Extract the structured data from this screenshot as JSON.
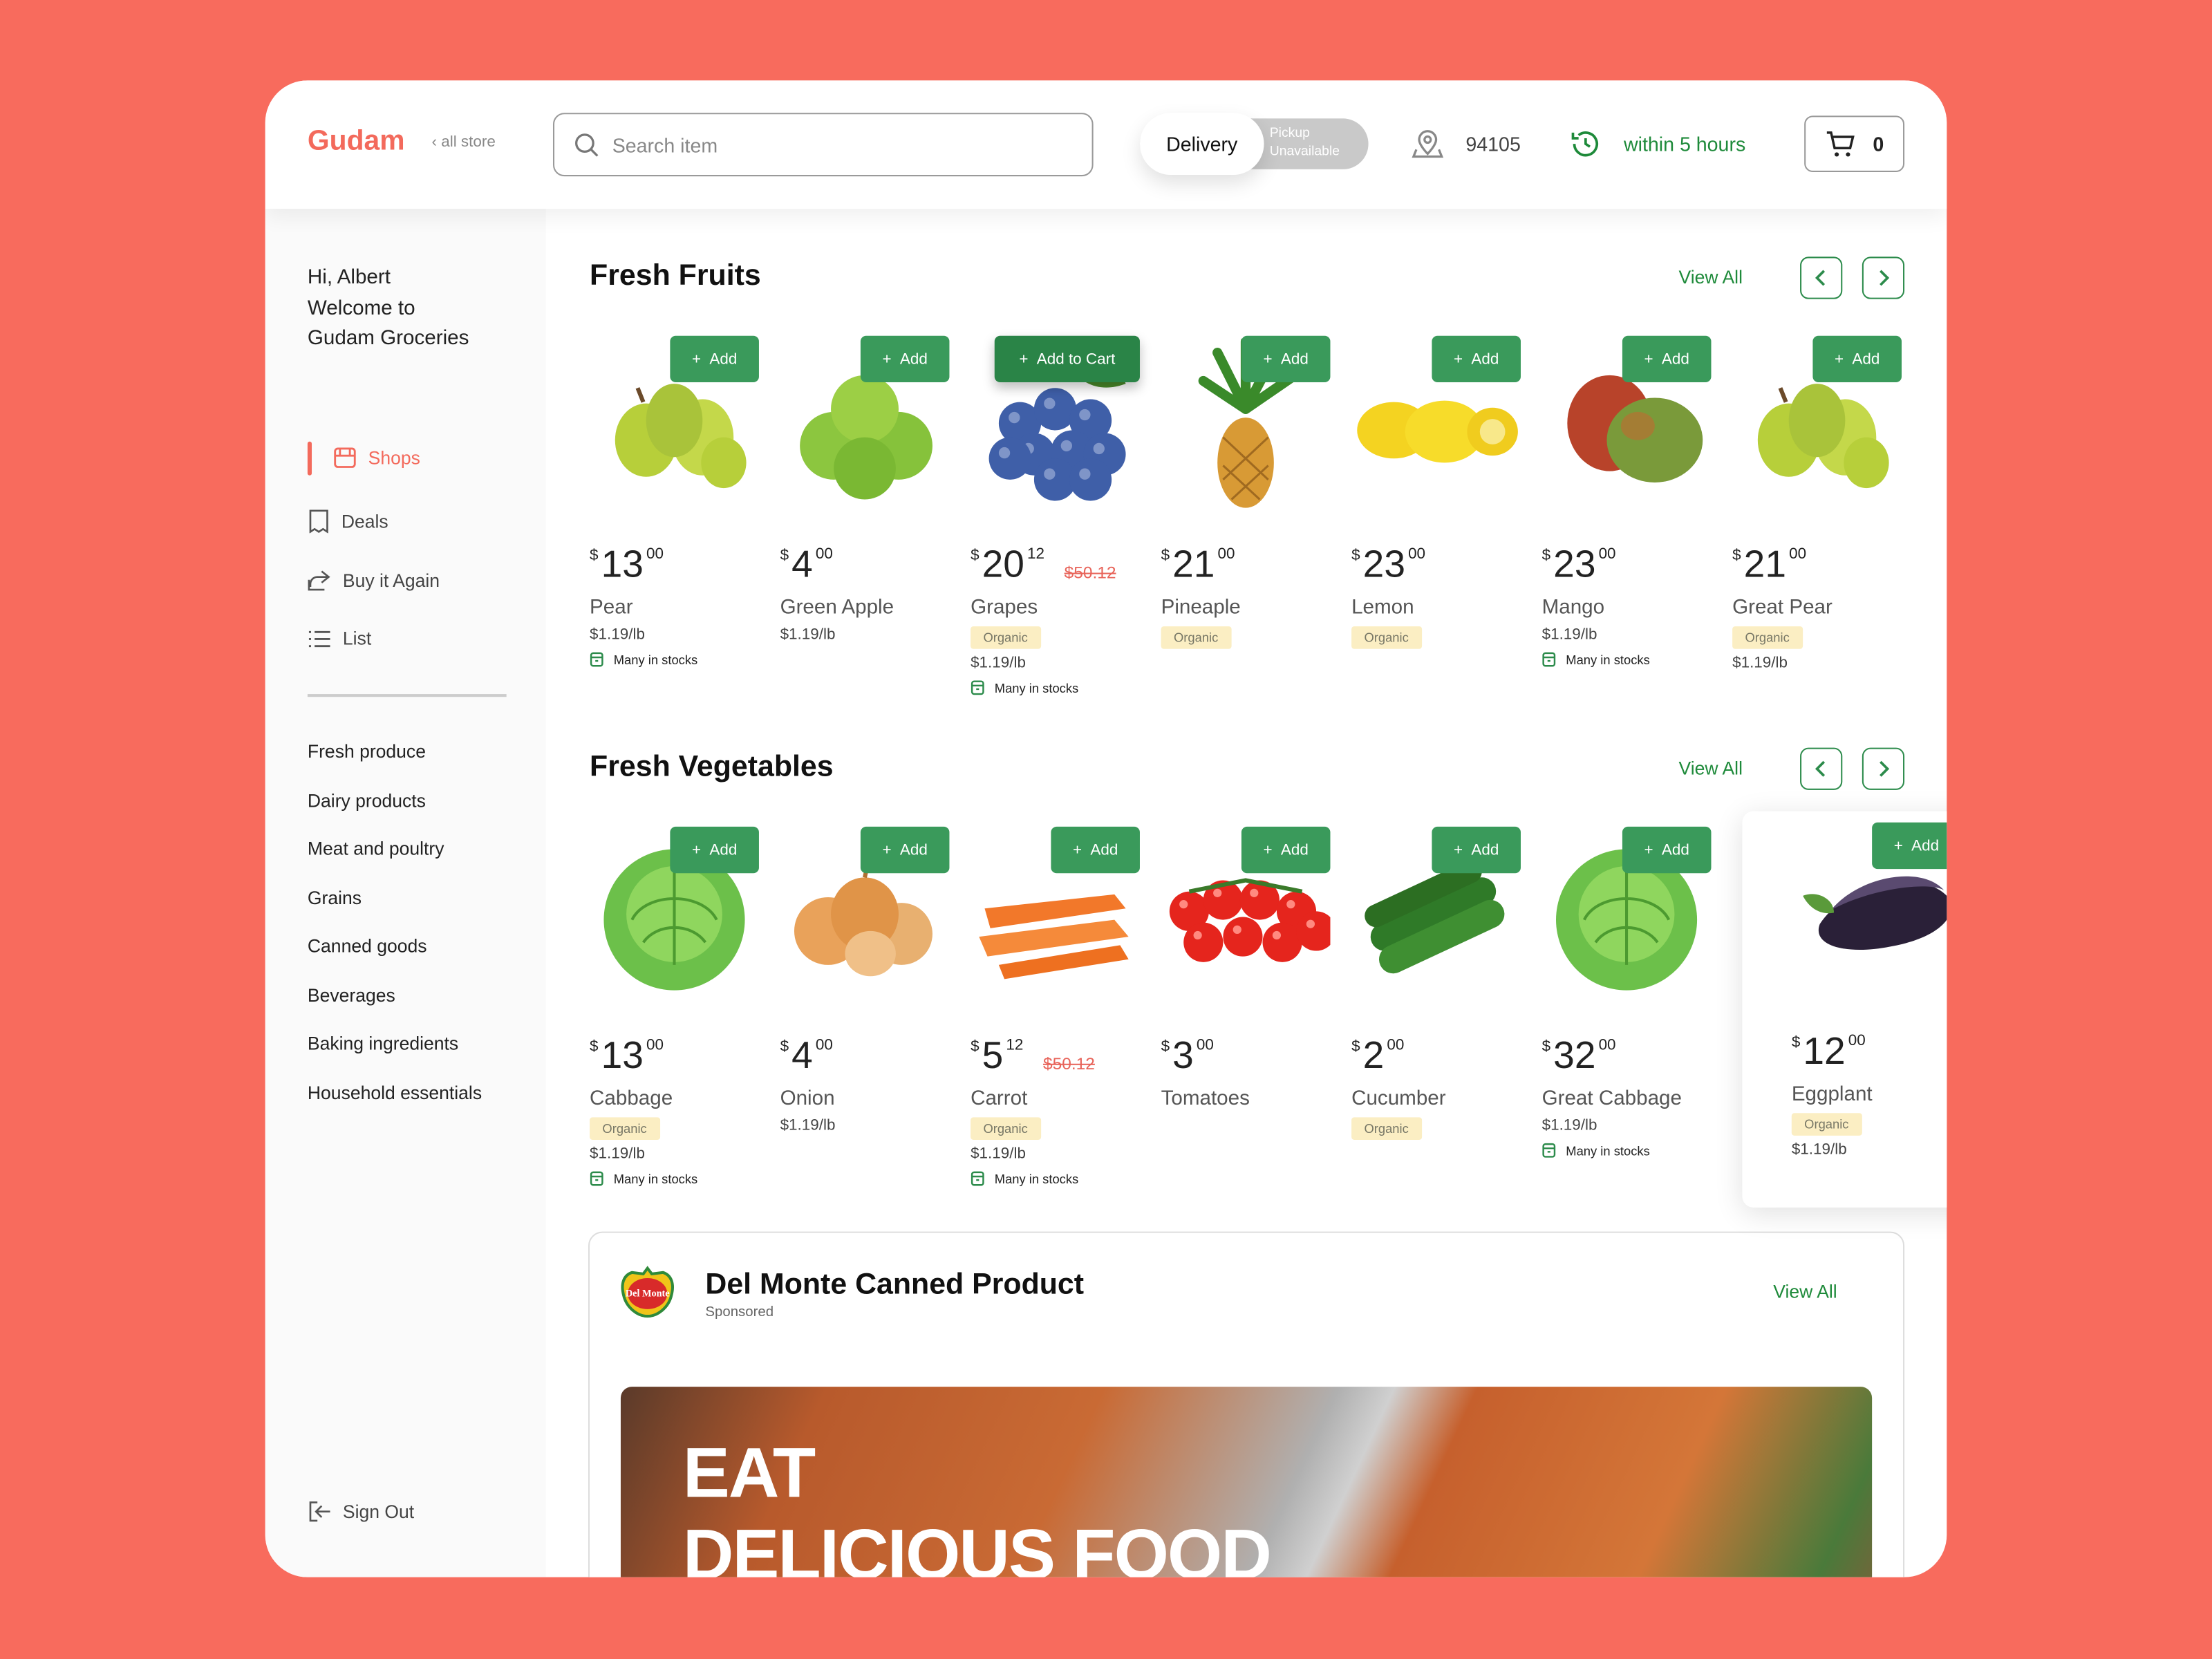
{
  "header": {
    "logo": "Gudam",
    "back_label": "all store",
    "search_placeholder": "Search item",
    "delivery_label": "Delivery",
    "pickup_label": "Pickup",
    "pickup_status": "Unavailable",
    "zip": "94105",
    "eta": "within 5 hours",
    "cart_count": "0"
  },
  "colors": {
    "brand": "#f36a5c",
    "accent_green": "#3a9a5b",
    "background": "#f86b5d",
    "organic_badge": "#fbeec3"
  },
  "sidebar": {
    "greeting": [
      "Hi, Albert",
      "Welcome to",
      "Gudam Groceries"
    ],
    "nav": [
      {
        "label": "Shops",
        "icon": "store-icon",
        "active": true
      },
      {
        "label": "Deals",
        "icon": "receipt-icon"
      },
      {
        "label": "Buy it Again",
        "icon": "share-icon"
      },
      {
        "label": "List",
        "icon": "list-icon"
      }
    ],
    "categories": [
      "Fresh produce",
      "Dairy products",
      "Meat and poultry",
      "Grains",
      "Canned goods",
      "Beverages",
      "Baking ingredients",
      "Household essentials"
    ],
    "sign_out": "Sign Out"
  },
  "sections": [
    {
      "title": "Fresh Fruits",
      "view_all": "View All",
      "products": [
        {
          "name": "Pear",
          "cur": "$",
          "whole": "13",
          "cents": "00",
          "per_lb": "$1.19/lb",
          "stock": "Many in stocks",
          "add": "Add",
          "icon": "pear",
          "color": "#b7cf3a"
        },
        {
          "name": "Green Apple",
          "cur": "$",
          "whole": "4",
          "cents": "00",
          "per_lb": "$1.19/lb",
          "add": "Add",
          "icon": "apple",
          "color": "#8cc63f"
        },
        {
          "name": "Grapes",
          "cur": "$",
          "whole": "20",
          "cents": "12",
          "old": "$50.12",
          "badge": "Organic",
          "per_lb": "$1.19/lb",
          "stock": "Many in stocks",
          "add": "Add to Cart",
          "icon": "blueberry",
          "color": "#3f5fa8"
        },
        {
          "name": "Pineaple",
          "cur": "$",
          "whole": "21",
          "cents": "00",
          "badge": "Organic",
          "add": "Add",
          "icon": "pineapple",
          "color": "#d89a35"
        },
        {
          "name": "Lemon",
          "cur": "$",
          "whole": "23",
          "cents": "00",
          "badge": "Organic",
          "add": "Add",
          "icon": "lemon",
          "color": "#f4d321"
        },
        {
          "name": "Mango",
          "cur": "$",
          "whole": "23",
          "cents": "00",
          "per_lb": "$1.19/lb",
          "stock": "Many in stocks",
          "add": "Add",
          "icon": "mango",
          "color": "#7a9a3a"
        },
        {
          "name": "Great Pear",
          "cur": "$",
          "whole": "21",
          "cents": "00",
          "badge": "Organic",
          "per_lb": "$1.19/lb",
          "add": "Add",
          "icon": "pear",
          "color": "#b7cf3a"
        }
      ]
    },
    {
      "title": "Fresh Vegetables",
      "view_all": "View All",
      "products": [
        {
          "name": "Cabbage",
          "cur": "$",
          "whole": "13",
          "cents": "00",
          "badge": "Organic",
          "per_lb": "$1.19/lb",
          "stock": "Many in stocks",
          "add": "Add",
          "icon": "cabbage",
          "color": "#6cc04a"
        },
        {
          "name": "Onion",
          "cur": "$",
          "whole": "4",
          "cents": "00",
          "per_lb": "$1.19/lb",
          "add": "Add",
          "icon": "onion",
          "color": "#e9a25a"
        },
        {
          "name": "Carrot",
          "cur": "$",
          "whole": "5",
          "cents": "12",
          "old": "$50.12",
          "badge": "Organic",
          "per_lb": "$1.19/lb",
          "stock": "Many in stocks",
          "add": "Add",
          "icon": "carrot",
          "color": "#f2782a"
        },
        {
          "name": "Tomatoes",
          "cur": "$",
          "whole": "3",
          "cents": "00",
          "add": "Add",
          "icon": "tomato",
          "color": "#e5251d"
        },
        {
          "name": "Cucumber",
          "cur": "$",
          "whole": "2",
          "cents": "00",
          "badge": "Organic",
          "add": "Add",
          "icon": "cucumber",
          "color": "#2f7a28"
        },
        {
          "name": "Great Cabbage",
          "cur": "$",
          "whole": "32",
          "cents": "00",
          "per_lb": "$1.19/lb",
          "stock": "Many in stocks",
          "add": "Add",
          "icon": "cabbage",
          "color": "#6cc04a"
        },
        {
          "name": "Eggplant",
          "cur": "$",
          "whole": "12",
          "cents": "00",
          "badge": "Organic",
          "per_lb": "$1.19/lb",
          "add": "Add",
          "icon": "eggplant",
          "color": "#2a2038",
          "highlighted": true
        }
      ]
    }
  ],
  "sponsored": {
    "brand_logo_text": "Del Monte",
    "title": "Del Monte Canned Product",
    "subtitle": "Sponsored",
    "view_all": "View All",
    "banner_line1": "EAT",
    "banner_line2": "DELICIOUS FOOD"
  }
}
